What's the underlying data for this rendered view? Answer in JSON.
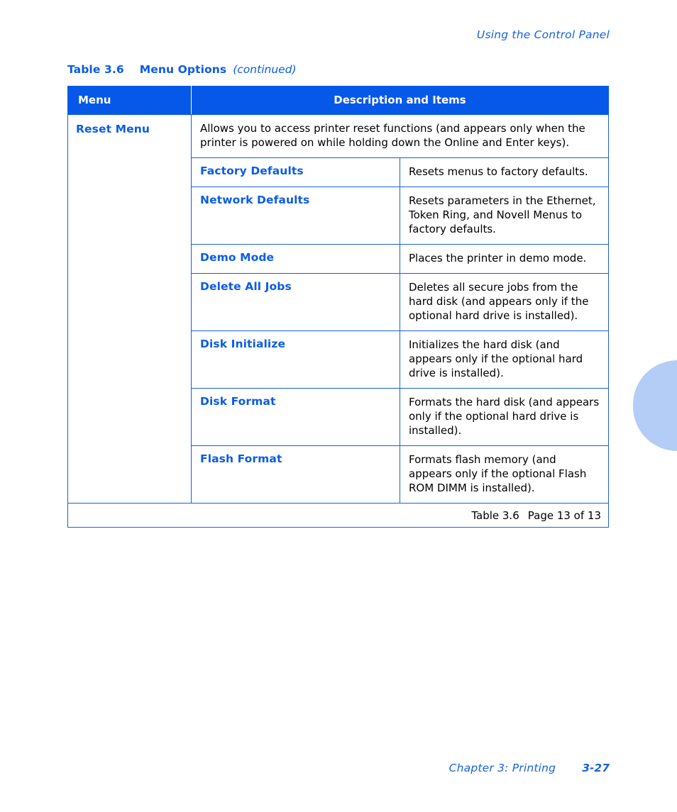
{
  "running_header": "Using the Control Panel",
  "table_caption": {
    "number": "Table 3.6",
    "title": "Menu Options",
    "continued": "(continued)"
  },
  "table": {
    "columns": [
      "Menu",
      "Description and Items"
    ],
    "menu_name": "Reset Menu",
    "intro": "Allows you to access printer reset functions (and appears only when the printer is powered on while holding down the Online and Enter keys).",
    "items": [
      {
        "name": "Factory Defaults",
        "description": "Resets menus to factory defaults."
      },
      {
        "name": "Network Defaults",
        "description": "Resets parameters in the Ethernet, Token Ring, and Novell Menus to factory defaults."
      },
      {
        "name": "Demo Mode",
        "description": "Places the printer in demo mode."
      },
      {
        "name": "Delete All Jobs",
        "description": "Deletes all secure jobs from the hard disk (and appears only if the optional hard drive is installed)."
      },
      {
        "name": "Disk Initialize",
        "description": "Initializes the hard disk (and appears only if the optional hard drive is installed)."
      },
      {
        "name": "Disk Format",
        "description": "Formats the hard disk (and appears only if the optional hard drive is installed)."
      },
      {
        "name": "Flash Format",
        "description": "Formats flash memory (and appears only if the optional Flash ROM DIMM is installed)."
      }
    ],
    "footer": {
      "table_label": "Table 3.6",
      "page_label": "Page 13 of 13"
    }
  },
  "page_footer": {
    "chapter": "Chapter 3: Printing",
    "folio": "3-27"
  },
  "colors": {
    "heading_blue": "#0658E8",
    "link_blue": "#0B5CE8",
    "rule_blue": "#1B60CE",
    "tab_blue": "#B3CDF7",
    "body_black": "#000000"
  }
}
